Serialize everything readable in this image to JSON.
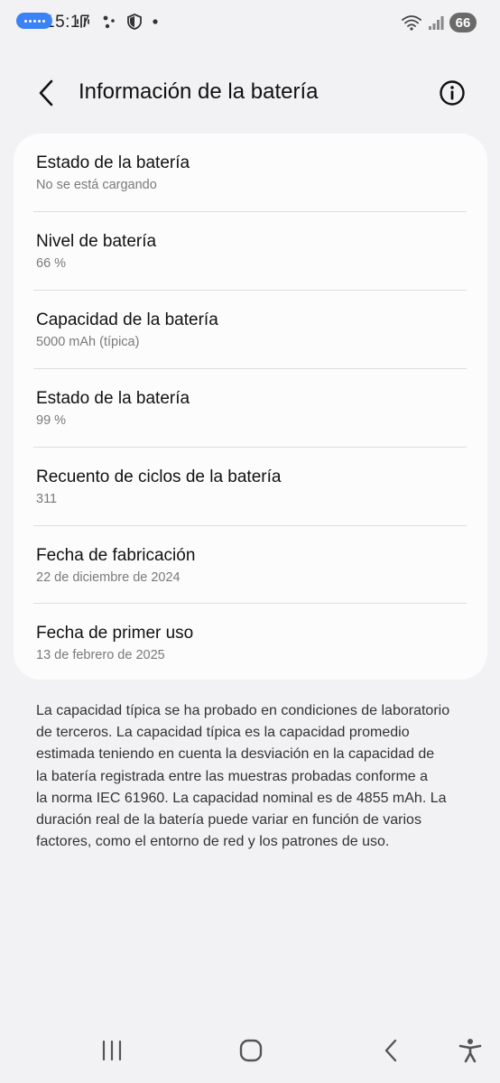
{
  "status_bar": {
    "time": "15:17",
    "battery_level": "66"
  },
  "header": {
    "title": "Información de la batería"
  },
  "battery_info": [
    {
      "label": "Estado de la batería",
      "value": "No se está cargando"
    },
    {
      "label": "Nivel de batería",
      "value": "66 %"
    },
    {
      "label": "Capacidad de la batería",
      "value": "5000 mAh (típica)"
    },
    {
      "label": "Estado de la batería",
      "value": "99 %"
    },
    {
      "label": "Recuento de ciclos de la batería",
      "value": "311"
    },
    {
      "label": "Fecha de fabricación",
      "value": "22 de diciembre de 2024"
    },
    {
      "label": "Fecha de primer uso",
      "value": "13 de febrero de 2025"
    }
  ],
  "footnote": {
    "lines": [
      "La capacidad típica se ha probado en condiciones de laboratorio",
      "de terceros. La capacidad típica es la capacidad promedio",
      "estimada teniendo en cuenta la desviación en la capacidad de",
      "la batería registrada entre las muestras probadas conforme a",
      "la norma IEC 61960. La capacidad nominal es de 4855 mAh. La",
      "duración real de la batería puede variar en función de varios",
      "factores, como el entorno de red y los patrones de uso."
    ]
  },
  "icons": {
    "back": "chevron-left-icon",
    "info": "info-circle-icon",
    "nav_recents": "recents-icon",
    "nav_home": "home-icon",
    "nav_back": "back-icon",
    "nav_accessibility": "accessibility-icon"
  },
  "colors": {
    "background": "#f2f2f4",
    "card": "#fcfcfc",
    "secondary_text": "#7a7a7a",
    "status_pill": "#3b82f6"
  }
}
